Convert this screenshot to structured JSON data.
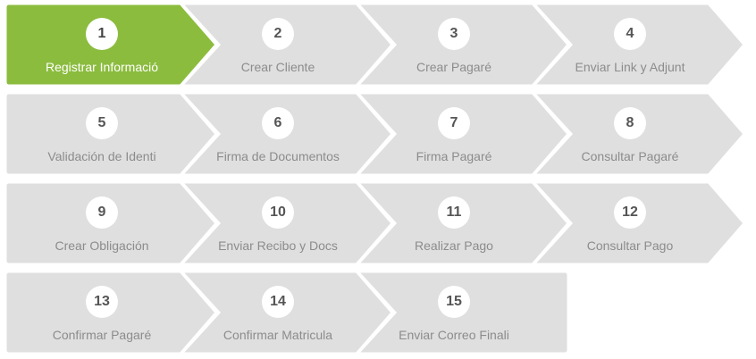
{
  "wizard": {
    "colors": {
      "active": "#8bbc3e",
      "inactive": "#dfdfdf",
      "label": "#8c8c8c",
      "active_label": "#ffffff",
      "number": "#555555"
    },
    "active_step": 1,
    "steps": [
      {
        "number": "1",
        "label": "Registrar Informació"
      },
      {
        "number": "2",
        "label": "Crear Cliente"
      },
      {
        "number": "3",
        "label": "Crear Pagaré"
      },
      {
        "number": "4",
        "label": "Enviar Link y Adjunt"
      },
      {
        "number": "5",
        "label": "Validación de Identi"
      },
      {
        "number": "6",
        "label": "Firma de Documentos"
      },
      {
        "number": "7",
        "label": "Firma Pagaré"
      },
      {
        "number": "8",
        "label": "Consultar Pagaré"
      },
      {
        "number": "9",
        "label": "Crear Obligación"
      },
      {
        "number": "10",
        "label": "Enviar Recibo y Docs"
      },
      {
        "number": "11",
        "label": "Realizar Pago"
      },
      {
        "number": "12",
        "label": "Consultar Pago"
      },
      {
        "number": "13",
        "label": "Confirmar Pagaré"
      },
      {
        "number": "14",
        "label": "Confirmar Matricula"
      },
      {
        "number": "15",
        "label": "Enviar Correo Finali"
      }
    ]
  }
}
